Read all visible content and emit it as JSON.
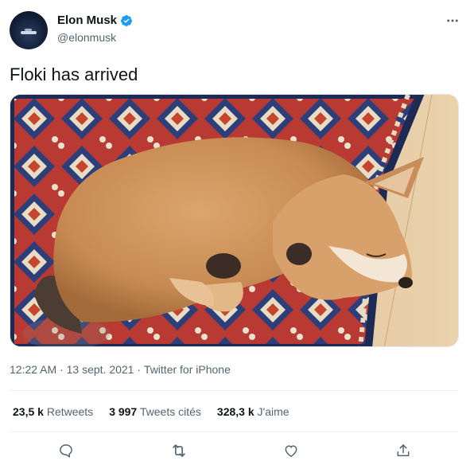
{
  "user": {
    "display_name": "Elon Musk",
    "handle": "@elonmusk",
    "verified": true
  },
  "tweet": {
    "text": "Floki has arrived",
    "image_alt": "Shiba Inu puppy sleeping on a patterned rug"
  },
  "meta": {
    "time": "12:22 AM",
    "separator": " · ",
    "date": "13 sept. 2021",
    "source": "Twitter for iPhone"
  },
  "stats": {
    "retweets": {
      "count": "23,5 k",
      "label": "Retweets"
    },
    "quotes": {
      "count": "3 997",
      "label": "Tweets cités"
    },
    "likes": {
      "count": "328,3 k",
      "label": "J'aime"
    }
  },
  "icons": {
    "more": "more-dots-icon",
    "reply": "reply-icon",
    "retweet": "retweet-icon",
    "like": "heart-icon",
    "share": "share-icon",
    "verified": "verified-badge-icon"
  },
  "colors": {
    "accent": "#1d9bf0",
    "text": "#0f1419",
    "secondary": "#536471"
  }
}
